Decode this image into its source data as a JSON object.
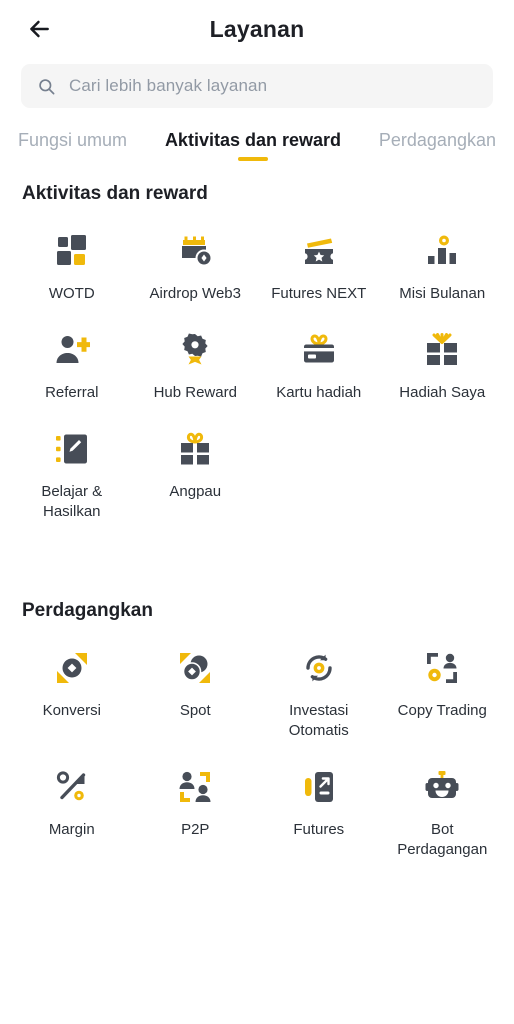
{
  "header": {
    "back_icon": "arrow-left-icon",
    "title": "Layanan"
  },
  "search": {
    "icon": "search-icon",
    "placeholder": "Cari lebih banyak layanan",
    "value": ""
  },
  "tabs": [
    {
      "label": "Fungsi umum",
      "active": false
    },
    {
      "label": "Aktivitas dan reward",
      "active": true
    },
    {
      "label": "Perdagangkan",
      "active": false
    }
  ],
  "colors": {
    "accent_yellow": "#F0B90B",
    "icon_dark": "#474D57",
    "text_primary": "#1E2026",
    "text_secondary": "#2B3139",
    "text_muted": "#A6AEB8",
    "search_bg": "#F5F5F5",
    "page_bg": "#FFFFFF"
  },
  "sections": [
    {
      "title": "Aktivitas dan reward",
      "items": [
        {
          "label": "WOTD",
          "icon": "squares-grid-icon"
        },
        {
          "label": "Airdrop Web3",
          "icon": "airdrop-box-icon"
        },
        {
          "label": "Futures NEXT",
          "icon": "ticket-star-icon"
        },
        {
          "label": "Misi Bulanan",
          "icon": "bar-chart-coin-icon"
        },
        {
          "label": "Referral",
          "icon": "person-plus-icon"
        },
        {
          "label": "Hub Reward",
          "icon": "medal-badge-icon"
        },
        {
          "label": "Kartu hadiah",
          "icon": "gift-card-icon"
        },
        {
          "label": "Hadiah Saya",
          "icon": "gift-box-icon"
        },
        {
          "label": "Belajar & Hasilkan",
          "icon": "notebook-pencil-icon"
        },
        {
          "label": "Angpau",
          "icon": "red-packet-gift-icon"
        }
      ]
    },
    {
      "title": "Perdagangkan",
      "items": [
        {
          "label": "Konversi",
          "icon": "convert-coin-icon"
        },
        {
          "label": "Spot",
          "icon": "spot-coins-icon"
        },
        {
          "label": "Investasi Otomatis",
          "icon": "auto-invest-refresh-icon"
        },
        {
          "label": "Copy Trading",
          "icon": "copy-trading-person-icon"
        },
        {
          "label": "Margin",
          "icon": "percent-arrow-icon"
        },
        {
          "label": "P2P",
          "icon": "two-people-icon"
        },
        {
          "label": "Futures",
          "icon": "futures-chart-icon"
        },
        {
          "label": "Bot Perdagangan",
          "icon": "robot-icon"
        }
      ]
    }
  ]
}
